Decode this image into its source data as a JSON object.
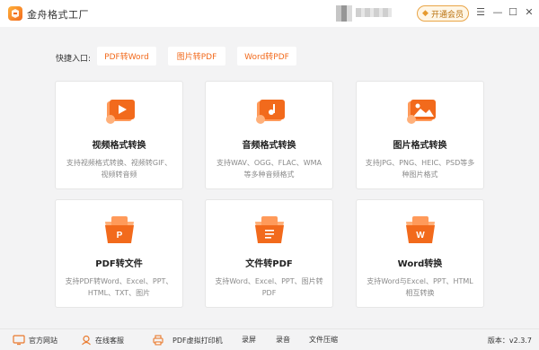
{
  "app": {
    "title": "金舟格式工厂"
  },
  "header": {
    "vip_label": "开通会员"
  },
  "window": {
    "menu": "☰",
    "minimize": "—",
    "maximize": "☐",
    "close": "✕"
  },
  "quick": {
    "label": "快捷入口:",
    "items": [
      "PDF转Word",
      "图片转PDF",
      "Word转PDF"
    ]
  },
  "cards": [
    {
      "title": "视频格式转换",
      "desc": "支持视频格式转换、视频转GIF、视频转音频",
      "icon": "video-convert-icon"
    },
    {
      "title": "音频格式转换",
      "desc": "支持WAV、OGG、FLAC、WMA等多种音频格式",
      "icon": "audio-convert-icon"
    },
    {
      "title": "图片格式转换",
      "desc": "支持JPG、PNG、HEIC、PSD等多种图片格式",
      "icon": "image-convert-icon"
    },
    {
      "title": "PDF转文件",
      "desc": "支持PDF转Word、Excel、PPT、HTML、TXT、图片",
      "icon": "pdf-convert-icon"
    },
    {
      "title": "文件转PDF",
      "desc": "支持Word、Excel、PPT、图片转PDF",
      "icon": "file-to-pdf-icon"
    },
    {
      "title": "Word转换",
      "desc": "支持Word与Excel、PPT、HTML相互转换",
      "icon": "word-convert-icon"
    }
  ],
  "bottom": {
    "items": [
      "官方网站",
      "在线客服",
      "PDF虚拟打印机",
      "录屏",
      "录音",
      "文件压缩"
    ],
    "version": "版本：v2.3.7"
  },
  "colors": {
    "accent": "#f26a1c",
    "accent_light": "#ff9a5a"
  }
}
